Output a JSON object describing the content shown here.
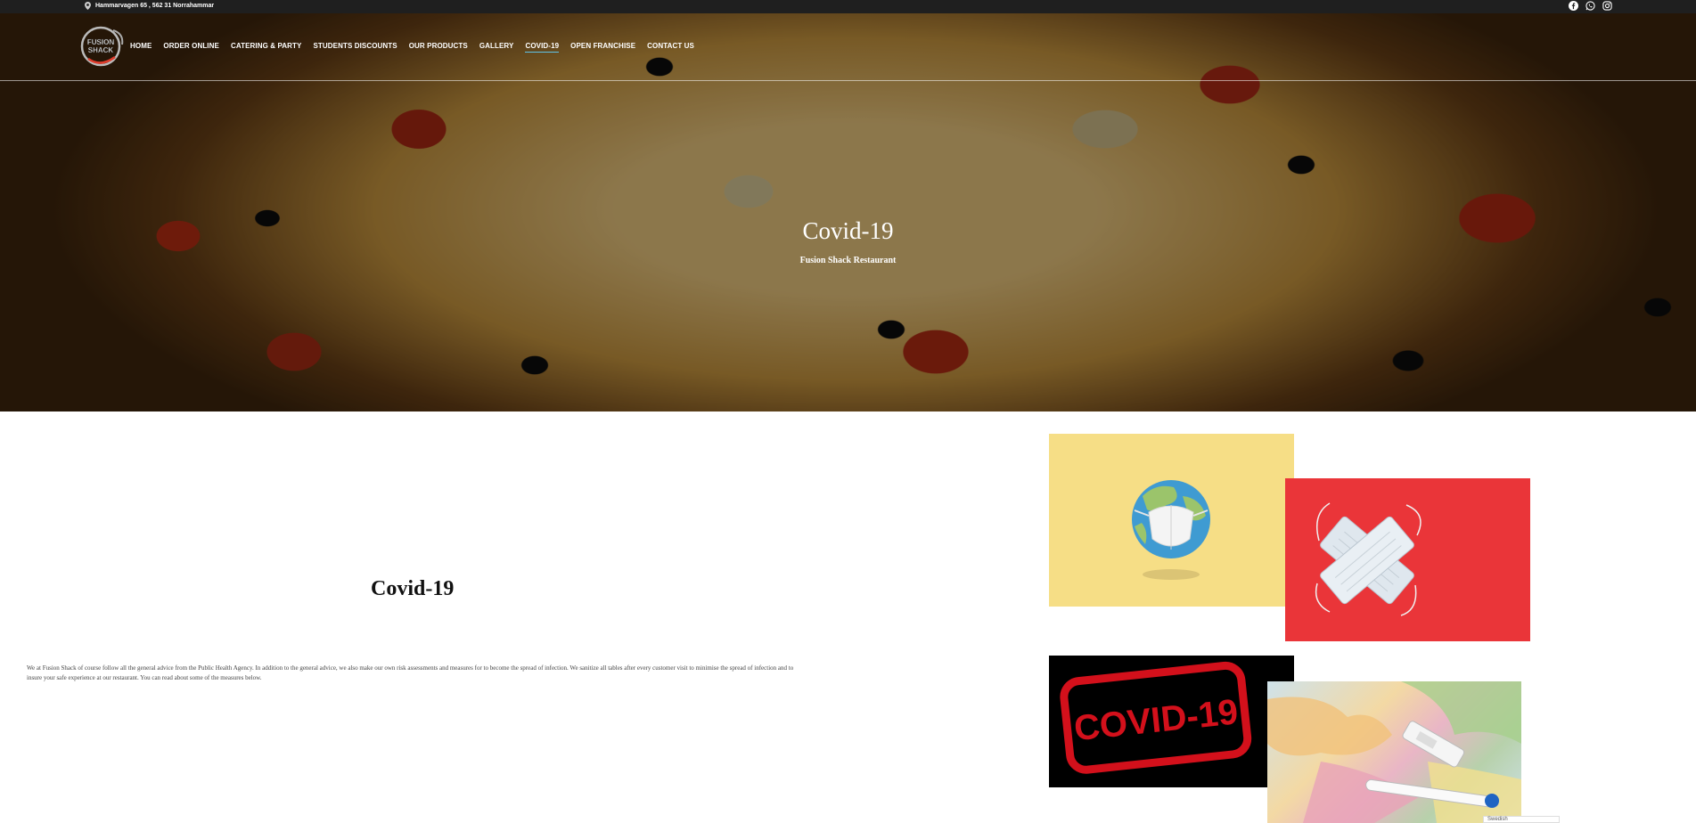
{
  "topbar": {
    "address": "Hammarvagen 65 , 562 31 Norrahammar",
    "socials": [
      "facebook-icon",
      "whatsapp-icon",
      "instagram-icon"
    ]
  },
  "nav": {
    "items": [
      {
        "label": "HOME"
      },
      {
        "label": "ORDER ONLINE"
      },
      {
        "label": "CATERING & PARTY"
      },
      {
        "label": "STUDENTS DISCOUNTS"
      },
      {
        "label": "OUR PRODUCTS"
      },
      {
        "label": "GALLERY"
      },
      {
        "label": "COVID-19"
      },
      {
        "label": "OPEN FRANCHISE"
      },
      {
        "label": "CONTACT US"
      }
    ],
    "active_color": "#5fc3e8"
  },
  "logo": {
    "text_line1": "FUSION",
    "text_line2": "SHACK"
  },
  "hero": {
    "title": "Covid-19",
    "subtitle": "Fusion Shack Restaurant"
  },
  "section": {
    "title": "Covid-19",
    "text": "We at Fusion Shack of course follow all the general advice from the Public Health Agency. In addition to the general advice, we also make our own risk assessments and measures for to become the spread of infection. We sanitize all tables after every customer visit to minimise the spread of infection and to insure your safe experience at our restaurant. You can read about some of the measures below."
  },
  "images": {
    "stamp_text": "COVID-19"
  },
  "language": {
    "selected": "Swedish"
  }
}
